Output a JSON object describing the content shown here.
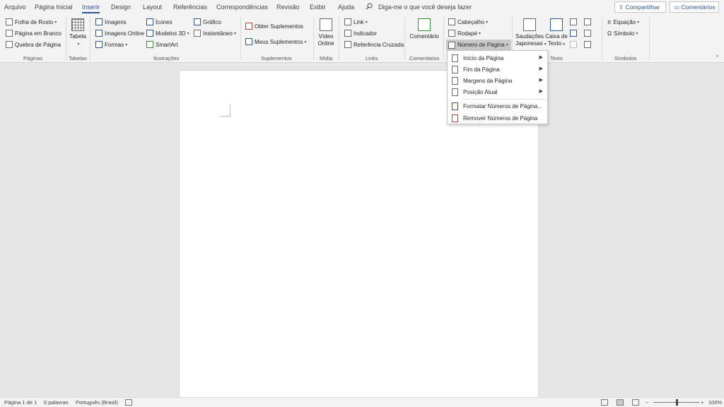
{
  "tabs": {
    "arquivo": "Arquivo",
    "pagina_inicial": "Página Inicial",
    "inserir": "Inserir",
    "design": "Design",
    "layout": "Layout",
    "referencias": "Referências",
    "correspondencias": "Correspondências",
    "revisao": "Revisão",
    "exibir": "Exibir",
    "ajuda": "Ajuda",
    "search_placeholder": "Diga-me o que você deseja fazer"
  },
  "actions": {
    "share": "Compartilhar",
    "comments": "Comentários"
  },
  "ribbon": {
    "paginas": {
      "folha_rosto": "Folha de Rosto",
      "pagina_branco": "Página em Branco",
      "quebra": "Quebra de Página",
      "label": "Páginas"
    },
    "tabelas": {
      "tabela": "Tabela",
      "label": "Tabelas"
    },
    "ilustracoes": {
      "imagens": "Imagens",
      "imagens_online": "Imagens Online",
      "formas": "Formas",
      "icones": "Ícones",
      "modelos3d": "Modelos 3D",
      "smartart": "SmartArt",
      "grafico": "Gráfico",
      "instantaneo": "Instantâneo",
      "label": "Ilustrações"
    },
    "suplementos": {
      "obter": "Obter Suplementos",
      "meus": "Meus Suplementos",
      "label": "Suplementos"
    },
    "midia": {
      "video_line1": "Vídeo",
      "video_line2": "Online",
      "label": "Mídia"
    },
    "links": {
      "link": "Link",
      "indicador": "Indicador",
      "referencia": "Referência Cruzada",
      "label": "Links"
    },
    "comentarios": {
      "comentario": "Comentário",
      "label": "Comentários"
    },
    "cabecalho": {
      "cabecalho": "Cabeçalho",
      "rodape": "Rodapé",
      "numero": "Número de Página"
    },
    "texto": {
      "saudacoes1": "Saudações",
      "saudacoes2": "Japonesas",
      "caixa1": "Caixa de",
      "caixa2": "Texto",
      "label": "Texto"
    },
    "simbolos": {
      "equacao": "Equação",
      "simbolo": "Símbolo",
      "label": "Símbolos"
    }
  },
  "dropdown": {
    "items": [
      "Início da Página",
      "Fim da Página",
      "Margens da Página",
      "Posição Atual",
      "Formatar Números de Página...",
      "Remover Números de Página"
    ]
  },
  "status": {
    "page": "Página 1 de 1",
    "words": "0 palavras",
    "language": "Português (Brasil)",
    "zoom": "100%"
  },
  "colors": {
    "accent": "#2b579a",
    "ribbon_bg": "#f3f3f3",
    "canvas_bg": "#e6e6e6"
  }
}
